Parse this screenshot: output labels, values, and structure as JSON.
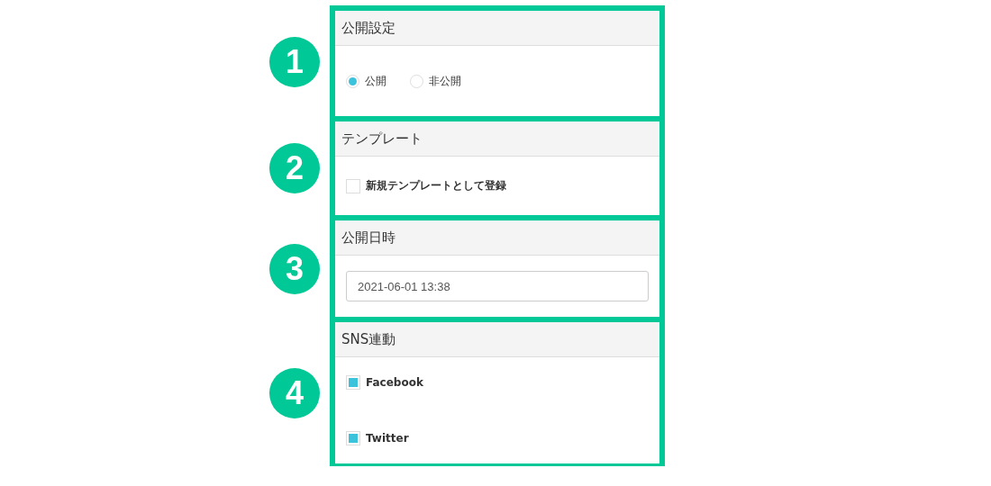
{
  "sections": [
    {
      "number": "1",
      "title": "公開設定",
      "kind": "radio",
      "options": [
        {
          "label": "公開",
          "selected": true
        },
        {
          "label": "非公開",
          "selected": false
        }
      ]
    },
    {
      "number": "2",
      "title": "テンプレート",
      "kind": "checkbox",
      "options": [
        {
          "label": "新規テンプレートとして登録",
          "checked": false
        }
      ]
    },
    {
      "number": "3",
      "title": "公開日時",
      "kind": "datetime",
      "value": "2021-06-01 13:38"
    },
    {
      "number": "4",
      "title": "SNS連動",
      "kind": "checklist",
      "options": [
        {
          "label": "Facebook",
          "checked": true
        },
        {
          "label": "Twitter",
          "checked": true
        }
      ]
    }
  ]
}
